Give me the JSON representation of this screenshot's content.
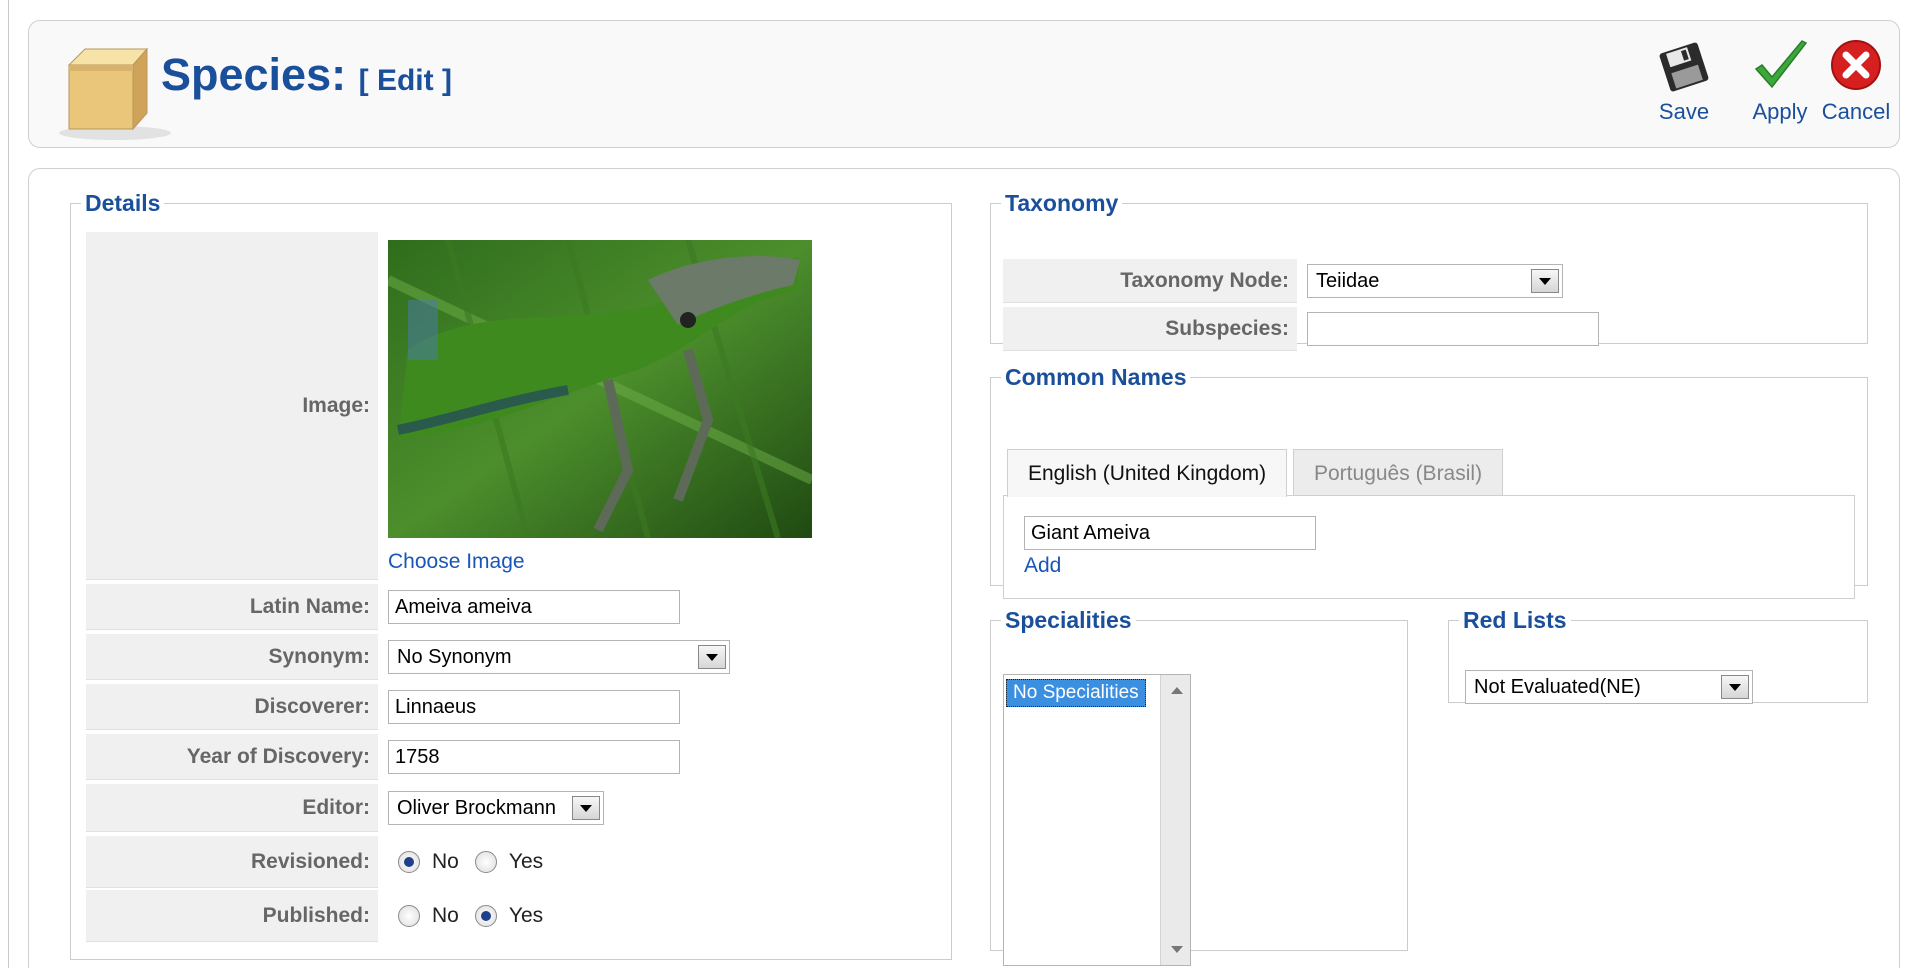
{
  "header": {
    "title": "Species:",
    "subtitle": "[ Edit ]"
  },
  "toolbar": {
    "save_label": "Save",
    "apply_label": "Apply",
    "cancel_label": "Cancel"
  },
  "details": {
    "legend": "Details",
    "image_label": "Image:",
    "choose_image": "Choose Image",
    "latin_name_label": "Latin Name:",
    "latin_name_value": "Ameiva ameiva",
    "synonym_label": "Synonym:",
    "synonym_value": "No Synonym",
    "discoverer_label": "Discoverer:",
    "discoverer_value": "Linnaeus",
    "year_label": "Year of Discovery:",
    "year_value": "1758",
    "editor_label": "Editor:",
    "editor_value": "Oliver Brockmann",
    "revisioned_label": "Revisioned:",
    "published_label": "Published:",
    "no_label": "No",
    "yes_label": "Yes"
  },
  "taxonomy": {
    "legend": "Taxonomy",
    "node_label": "Taxonomy Node:",
    "node_value": "Teiidae",
    "subspecies_label": "Subspecies:",
    "subspecies_value": ""
  },
  "common_names": {
    "legend": "Common Names",
    "tabs": [
      "English (United Kingdom)",
      "Português (Brasil)"
    ],
    "name_value": "Giant Ameiva",
    "add_label": "Add"
  },
  "specialities": {
    "legend": "Specialities",
    "selected_option": "No Specialities"
  },
  "red_lists": {
    "legend": "Red Lists",
    "value": "Not Evaluated(NE)"
  }
}
